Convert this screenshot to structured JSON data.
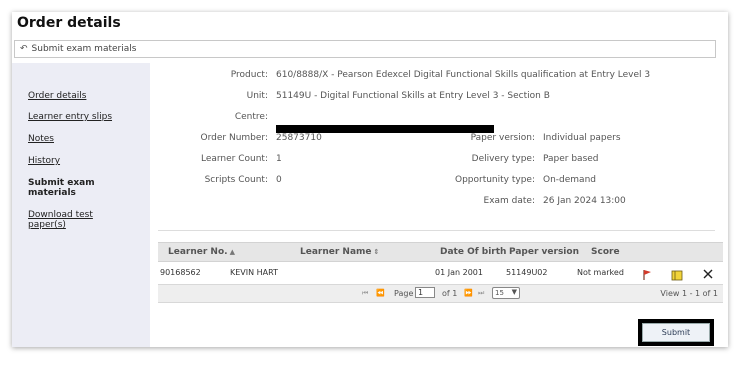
{
  "page": {
    "title": "Order details"
  },
  "breadcrumb": {
    "icon": "back-arrow-icon",
    "label": "Submit exam materials"
  },
  "sidebar": {
    "items": [
      {
        "label": "Order details",
        "active": false
      },
      {
        "label": "Learner entry slips",
        "active": false
      },
      {
        "label": "Notes",
        "active": false
      },
      {
        "label": "History",
        "active": false
      },
      {
        "label": "Submit exam materials",
        "active": true
      },
      {
        "label": "Download test paper(s)",
        "active": false
      }
    ]
  },
  "details": {
    "product_label": "Product:",
    "product_value": "610/8888/X - Pearson Edexcel Digital Functional Skills qualification at Entry Level 3",
    "unit_label": "Unit:",
    "unit_value": "51149U - Digital Functional Skills at Entry Level 3 - Section B",
    "centre_label": "Centre:",
    "order_number_label": "Order Number:",
    "order_number_value": "25873710",
    "learner_count_label": "Learner Count:",
    "learner_count_value": "1",
    "scripts_count_label": "Scripts Count:",
    "scripts_count_value": "0",
    "paper_version_label": "Paper version:",
    "paper_version_value": "Individual papers",
    "delivery_type_label": "Delivery type:",
    "delivery_type_value": "Paper based",
    "opportunity_type_label": "Opportunity type:",
    "opportunity_type_value": "On-demand",
    "exam_date_label": "Exam date:",
    "exam_date_value": "26 Jan 2024 13:00"
  },
  "table": {
    "columns": [
      "Learner No.",
      "Learner Name",
      "Date Of birth",
      "Paper version",
      "Score"
    ],
    "rows": [
      {
        "learner_no": "90168562",
        "learner_name": "KEVIN HART",
        "dob": "01 Jan 2001",
        "paper_version": "51149U02",
        "score": "Not marked"
      }
    ]
  },
  "pager": {
    "page_label": "Page",
    "current_page": "1",
    "of_label": "of 1",
    "page_size": "15",
    "view_text": "View 1 - 1 of 1"
  },
  "actions": {
    "submit_label": "Submit"
  },
  "colors": {
    "sidebar_bg": "#ecedf5",
    "grid_header_bg": "#e6e6e6",
    "redaction": "#000000"
  }
}
